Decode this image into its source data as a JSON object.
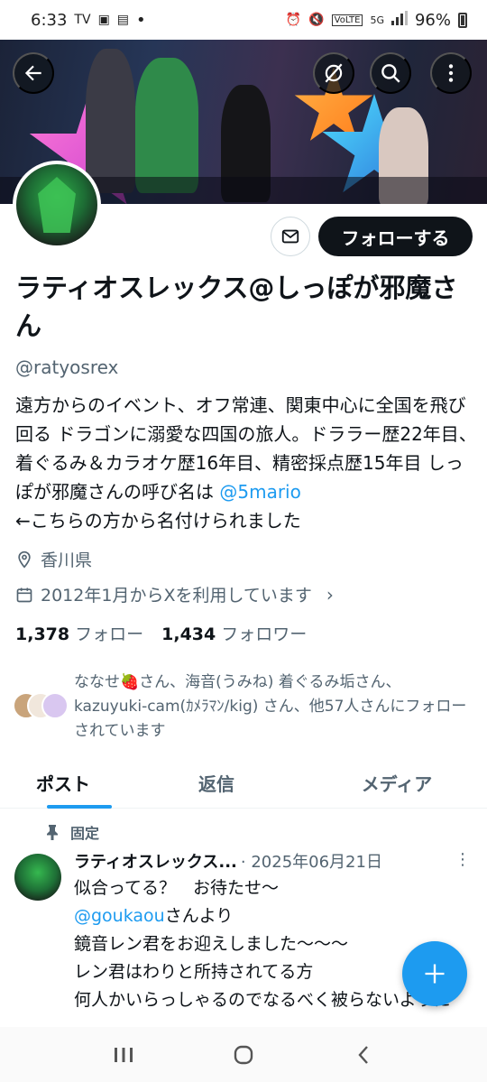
{
  "status_bar": {
    "time": "6:33",
    "left_icons": [
      "tver-icon",
      "gallery-icon",
      "news-icon"
    ],
    "dot": "•",
    "right_icons": [
      "alarm-icon",
      "mute-icon",
      "volte-icon",
      "5g-icon",
      "signal-icon"
    ],
    "battery": "96%"
  },
  "profile": {
    "display_name": "ラティオスレックス@しっぽが邪魔さん",
    "handle": "@ratyosrex",
    "bio_text": "遠方からのイベント、オフ常連、関東中心に全国を飛び回る ドラゴンに溺愛な四国の旅人。ドララー歴22年目、着ぐるみ＆カラオケ歴16年目、精密採点歴15年目 しっぽが邪魔さんの呼び名は ",
    "bio_link": "@5mario",
    "bio_after": "←こちらの方から名付けられました",
    "location": "香川県",
    "joined": "2012年1月からXを利用しています",
    "following_count": "1,378",
    "following_label": "フォロー",
    "followers_count": "1,434",
    "followers_label": "フォロワー",
    "followed_by": "ななせ🍓さん、海音(うみね) 着ぐるみ垢さん、kazuyuki-cam(ｶﾒﾗﾏﾝ/kig) さん、他57人さんにフォローされています"
  },
  "actions": {
    "follow_label": "フォローする"
  },
  "tabs": [
    {
      "label": "ポスト"
    },
    {
      "label": "返信"
    },
    {
      "label": "メディア"
    }
  ],
  "pinned_post": {
    "pinned_label": "固定",
    "author": "ラティオスレックス...",
    "date": "· 2025年06月21日",
    "more": "⋮",
    "body": "似合ってる？　お待たせ〜\n@goukaouさんより\n鏡音レン君をお迎えしました〜〜〜\nレン君はわりと所持されてる方\n何人かいらっしゃるのでなるべく被らないように"
  },
  "colors": {
    "accent": "#1d9bf0",
    "text": "#0f1419",
    "muted": "#536471"
  }
}
